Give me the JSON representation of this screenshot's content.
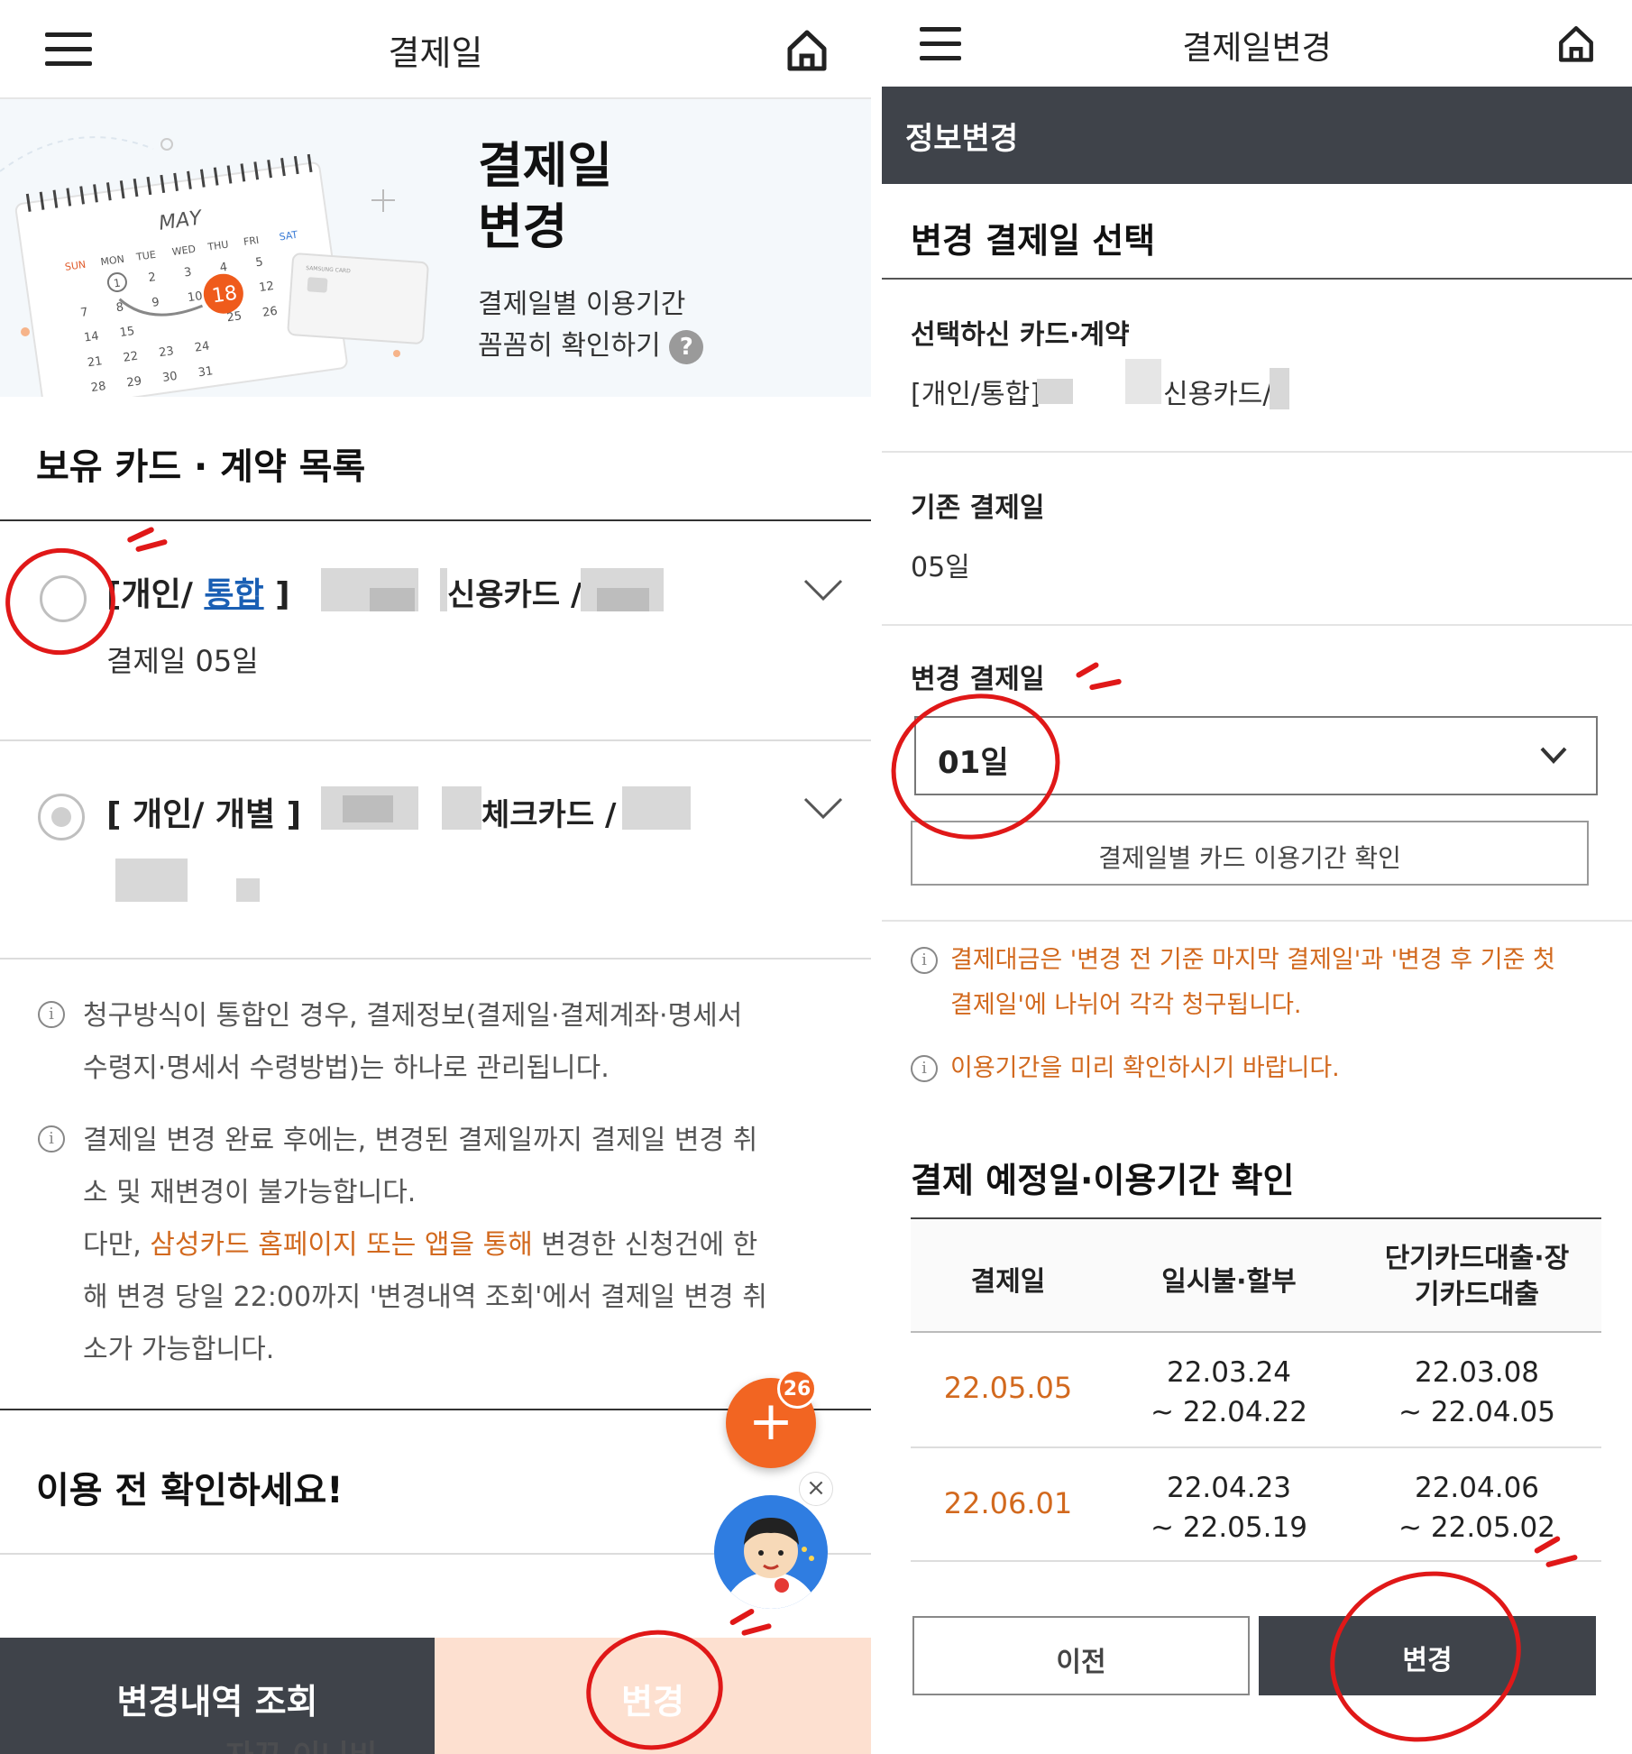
{
  "left": {
    "header": {
      "title": "결제일"
    },
    "banner": {
      "title_line1": "결제일",
      "title_line2": "변경",
      "desc_line1": "결제일별 이용기간",
      "desc_line2": "꼼꼼히 확인하기",
      "help_glyph": "?",
      "calendar": {
        "month": "MAY",
        "weekdays": [
          "SUN",
          "MON",
          "TUE",
          "WED",
          "THU",
          "FRI",
          "SAT"
        ],
        "highlight": "18",
        "circled": "1",
        "card_brand": "SAMSUNG CARD"
      }
    },
    "section_title": "보유 카드 · 계약 목록",
    "cards": [
      {
        "tag_prefix": "[개인/ ",
        "tag_link": "통합",
        "tag_suffix": " ]",
        "type_label": "신용카드 /",
        "detail": "결제일 05일"
      },
      {
        "tag_prefix": "[ 개인/ 개별 ]",
        "type_label": "체크카드 /"
      }
    ],
    "notices": [
      {
        "line1": "청구방식이 통합인 경우, 결제정보(결제일·결제계좌·명세서",
        "line2": "수령지·명세서 수령방법)는 하나로 관리됩니다."
      },
      {
        "line1": "결제일 변경 완료 후에는, 변경된 결제일까지 결제일 변경 취",
        "line2": "소 및 재변경이 불가능합니다.",
        "line3_prefix": "다만, ",
        "line3_highlight": "삼성카드 홈페이지 또는 앱을 통해",
        "line3_suffix": " 변경한 신청건에 한",
        "line4": "해 변경 당일 22:00까지 '변경내역 조회'에서 결제일 변경 취",
        "line5": "소가 가능합니다."
      }
    ],
    "confirm_title": "이용 전 확인하세요!",
    "fab": {
      "badge": "26",
      "plus": "+",
      "close": "×"
    },
    "bottom": {
      "history_label": "변경내역 조회",
      "change_label": "변경",
      "peek_text": "자꾸 이니비"
    }
  },
  "right": {
    "header": {
      "title": "결제일변경"
    },
    "band_title": "정보변경",
    "section_title": "변경 결제일 선택",
    "selected_label": "선택하신 카드·계약",
    "selected_prefix": "[개인/통합]",
    "selected_type": "신용카드/",
    "current_label": "기존 결제일",
    "current_value": "05일",
    "change_label": "변경 결제일",
    "select_value": "01일",
    "check_button": "결제일별 카드 이용기간 확인",
    "notices": [
      {
        "line1": "결제대금은 '변경 전 기준 마지막 결제일'과 '변경 후 기준 첫",
        "line2": "결제일'에 나뉘어 각각 청구됩니다."
      },
      {
        "line1": "이용기간을 미리 확인하시기 바랍니다."
      }
    ],
    "table_title": "결제 예정일·이용기간 확인",
    "table": {
      "headers": [
        "결제일",
        "일시불·할부",
        "단기카드대출·장\n기카드대출"
      ],
      "header3_line1": "단기카드대출·장",
      "header3_line2": "기카드대출",
      "rows": [
        {
          "date": "22.05.05",
          "lump_from": "22.03.24",
          "lump_to": "~ 22.04.22",
          "loan_from": "22.03.08",
          "loan_to": "~ 22.04.05"
        },
        {
          "date": "22.06.01",
          "lump_from": "22.04.23",
          "lump_to": "~ 22.05.19",
          "loan_from": "22.04.06",
          "loan_to": "~ 22.05.02"
        }
      ]
    },
    "buttons": {
      "prev": "이전",
      "change": "변경"
    }
  },
  "colors": {
    "dark": "#3f434a",
    "orange": "#d2691e",
    "fab_orange": "#f26522",
    "peach": "#fde0d0",
    "link_blue": "#1a5fb4",
    "annotation_red": "#e01818"
  }
}
